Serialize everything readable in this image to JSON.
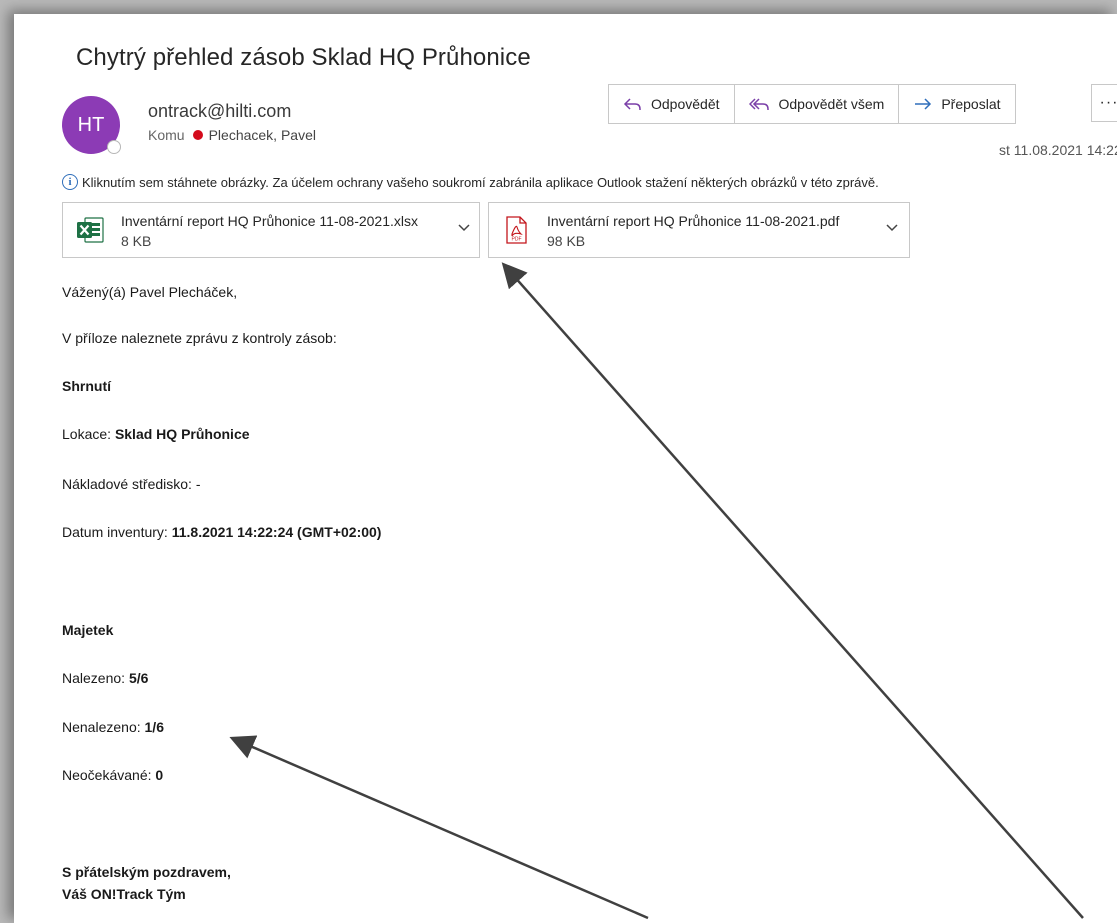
{
  "email": {
    "subject": "Chytrý přehled zásob Sklad HQ Průhonice",
    "avatar_initials": "HT",
    "avatar_color": "#8c3bb5",
    "sender": "ontrack@hilti.com",
    "to_label": "Komu",
    "recipient": "Plechacek, Pavel",
    "date": "st 11.08.2021 14:22",
    "info_text": "Kliknutím sem stáhnete obrázky. Za účelem ochrany vašeho soukromí zabránila aplikace Outlook stažení některých obrázků v této zprávě."
  },
  "actions": {
    "reply": "Odpovědět",
    "reply_all": "Odpovědět všem",
    "forward": "Přeposlat",
    "more": "···"
  },
  "attachments": [
    {
      "name": "Inventární report HQ Průhonice 11-08-2021.xlsx",
      "size": "8 KB",
      "icon": "excel-icon"
    },
    {
      "name": "Inventární report HQ Průhonice 11-08-2021.pdf",
      "size": "98 KB",
      "icon": "pdf-icon"
    }
  ],
  "body": {
    "greeting": "Vážený(á) Pavel Plecháček,",
    "intro": "V příloze naleznete zprávu z kontroly zásob:",
    "summary_heading": "Shrnutí",
    "location_label": "Lokace: ",
    "location_value": "Sklad HQ Průhonice",
    "cost_center_label": "Nákladové středisko: -",
    "date_label": "Datum inventury: ",
    "date_value": "11.8.2021 14:22:24 (GMT+02:00)",
    "assets_heading": "Majetek",
    "found_label": "Nalezeno: ",
    "found_value": "5/6",
    "not_found_label": "Nenalezeno: ",
    "not_found_value": "1/6",
    "unexpected_label": "Neočekávané: ",
    "unexpected_value": "0",
    "signoff_1": "S přátelským pozdravem,",
    "signoff_2": "Váš ON!Track Tým"
  }
}
